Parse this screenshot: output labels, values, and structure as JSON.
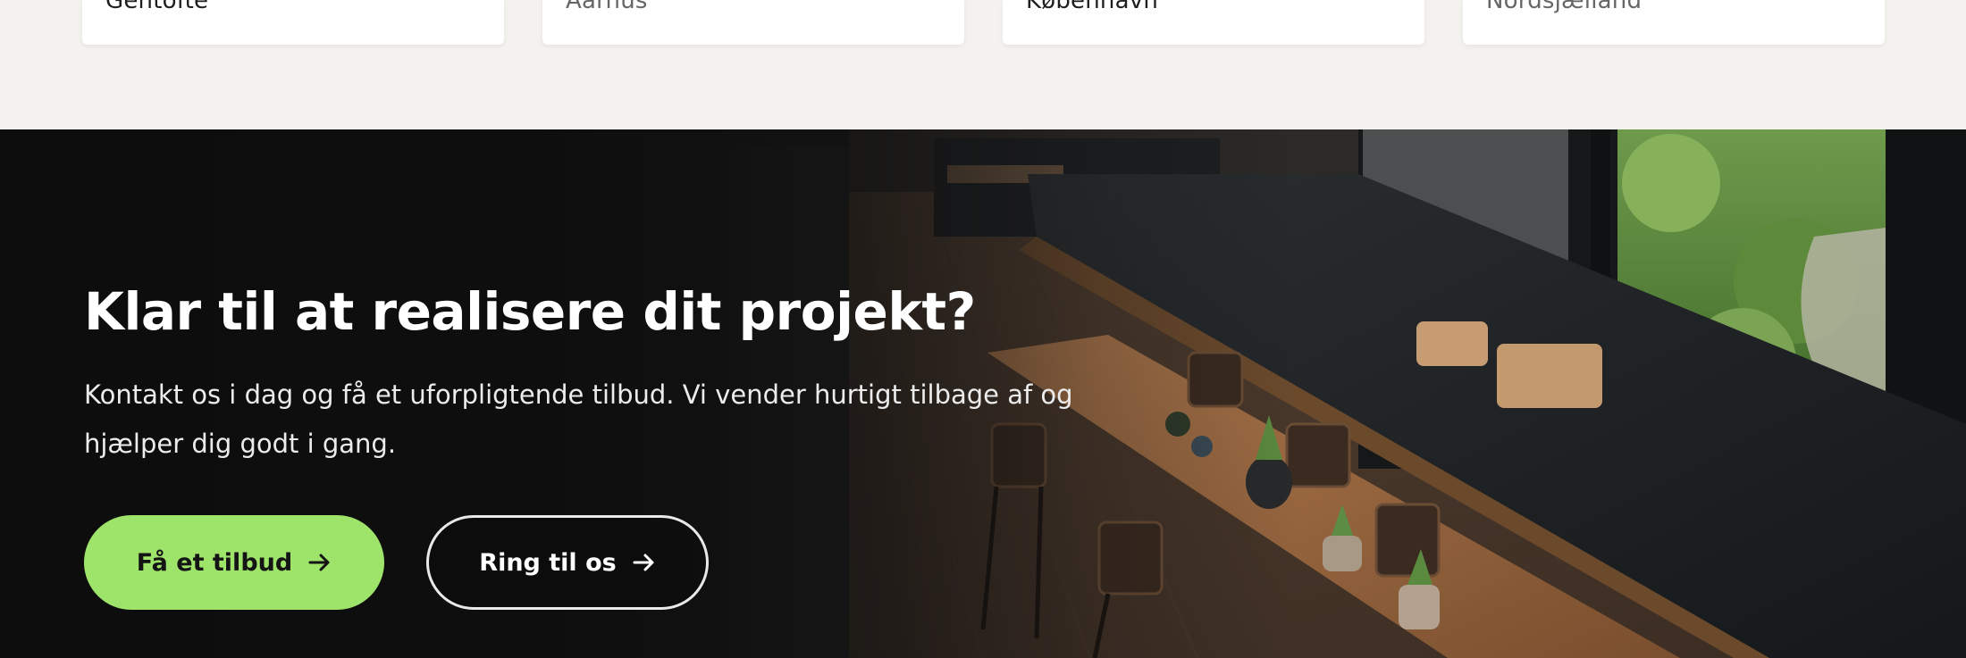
{
  "locations": [
    {
      "label": "Gentofte"
    },
    {
      "label": "Aarhus"
    },
    {
      "label": "København"
    },
    {
      "label": "Nordsjælland"
    }
  ],
  "cta": {
    "headline": "Klar til at realisere dit projekt?",
    "lead": "Kontakt os i dag og få et uforpligtende tilbud. Vi vender hurtigt tilbage af og hjælper dig godt i gang.",
    "primary_label": "Få et tilbud",
    "secondary_label": "Ring til os"
  },
  "colors": {
    "accent": "#9ee36a",
    "dark": "#121212",
    "background": "#f4f2ee"
  },
  "icons": {
    "button_arrow": "arrow-right-icon"
  }
}
